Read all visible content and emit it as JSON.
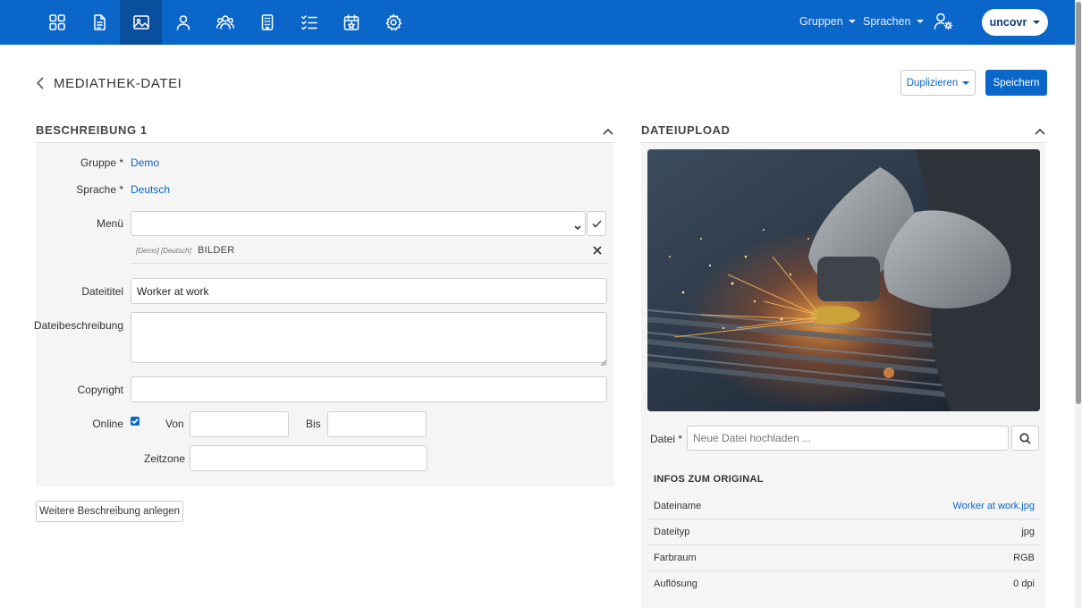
{
  "nav": {
    "icons": [
      "dashboard-icon",
      "document-icon",
      "image-icon",
      "user-icon",
      "users-icon",
      "building-icon",
      "checklist-icon",
      "calendar-icon",
      "gear-icon"
    ],
    "active_index": 2,
    "groups_label": "Gruppen",
    "languages_label": "Sprachen",
    "account_label": "uncovr"
  },
  "page": {
    "title": "MEDIATHEK-DATEI",
    "duplicate_label": "Duplizieren",
    "save_label": "Speichern"
  },
  "description": {
    "section_title": "BESCHREIBUNG 1",
    "group_label": "Gruppe *",
    "group_value": "Demo",
    "language_label": "Sprache *",
    "language_value": "Deutsch",
    "menu_label": "Menü",
    "menu_value": "",
    "menu_item_prefix": "[Demo] [Deutsch]",
    "menu_item_name": "BILDER",
    "title_label": "Dateititel",
    "title_value": "Worker at work",
    "desc_label": "Dateibeschreibung",
    "desc_value": "",
    "copyright_label": "Copyright",
    "copyright_value": "",
    "online_label": "Online",
    "online_checked": true,
    "from_label": "Von",
    "from_value": "",
    "to_label": "Bis",
    "to_value": "",
    "timezone_label": "Zeitzone",
    "timezone_value": "",
    "add_more_label": "Weitere Beschreibung anlegen"
  },
  "upload": {
    "section_title": "DATEIUPLOAD",
    "file_label": "Datei *",
    "file_placeholder": "Neue Datei hochladen ...",
    "infos_title": "INFOS ZUM ORIGINAL",
    "rows": [
      {
        "key": "Dateiname",
        "value": "Worker at work.jpg",
        "link": true
      },
      {
        "key": "Dateityp",
        "value": "jpg",
        "link": false
      },
      {
        "key": "Farbraum",
        "value": "RGB",
        "link": false
      },
      {
        "key": "Auflösung",
        "value": "0 dpi",
        "link": false
      }
    ]
  },
  "colors": {
    "primary": "#0b66c9",
    "nav_active": "#0a4f9e",
    "panel_bg": "#f5f5f5"
  }
}
